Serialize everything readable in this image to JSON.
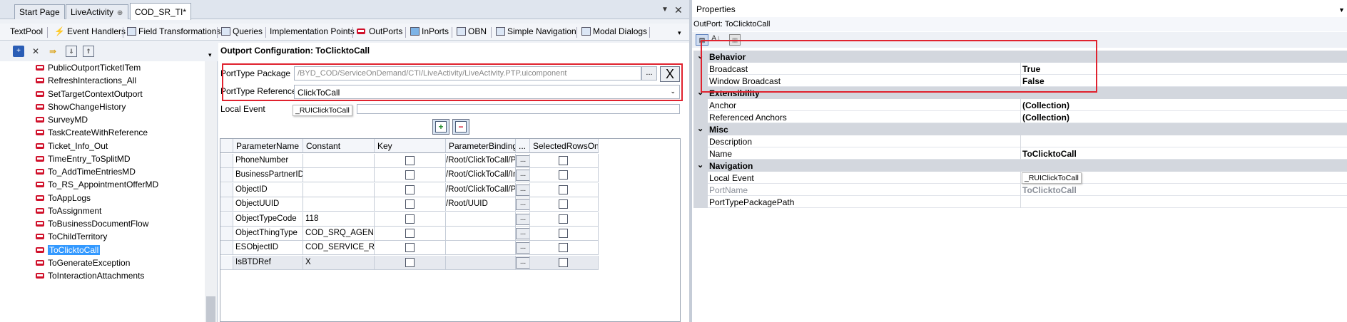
{
  "tabs": [
    {
      "label": "Start Page"
    },
    {
      "label": "LiveActivity"
    },
    {
      "label": "COD_SR_TI*"
    }
  ],
  "subtabs": [
    {
      "label": "TextPool",
      "icon": "textpool-icon"
    },
    {
      "label": "Event Handlers",
      "icon": "lightning-icon"
    },
    {
      "label": "Field Transformations",
      "icon": "transform-icon"
    },
    {
      "label": "Queries",
      "icon": "query-icon"
    },
    {
      "label": "Implementation Points",
      "icon": ""
    },
    {
      "label": "OutPorts",
      "icon": "outport-icon"
    },
    {
      "label": "InPorts",
      "icon": "inport-icon"
    },
    {
      "label": "OBN",
      "icon": "obn-icon"
    },
    {
      "label": "Simple Navigation",
      "icon": "navigation-icon"
    },
    {
      "label": "Modal Dialogs",
      "icon": "dialog-icon"
    }
  ],
  "tree": {
    "items": [
      {
        "label": "PublicOutportTicketITem"
      },
      {
        "label": "RefreshInteractions_All"
      },
      {
        "label": "SetTargetContextOutport"
      },
      {
        "label": "ShowChangeHistory"
      },
      {
        "label": "SurveyMD"
      },
      {
        "label": "TaskCreateWithReference"
      },
      {
        "label": "Ticket_Info_Out"
      },
      {
        "label": "TimeEntry_ToSplitMD"
      },
      {
        "label": "To_AddTimeEntriesMD"
      },
      {
        "label": "To_RS_AppointmentOfferMD"
      },
      {
        "label": "ToAppLogs"
      },
      {
        "label": "ToAssignment"
      },
      {
        "label": "ToBusinessDocumentFlow"
      },
      {
        "label": "ToChildTerritory"
      },
      {
        "label": "ToClicktoCall"
      },
      {
        "label": "ToGenerateException"
      },
      {
        "label": "ToInteractionAttachments"
      }
    ],
    "selected": "ToClicktoCall"
  },
  "config": {
    "title": "Outport Configuration: ToClicktoCall",
    "porttype_package_label": "PortType Package",
    "porttype_package_value": "/BYD_COD/ServiceOnDemand/CTI/LiveActivity/LiveActivity.PTP.uicomponent",
    "browse_label": "...",
    "clear_label": "X",
    "porttype_reference_label": "PortType Reference",
    "porttype_reference_value": "ClickToCall",
    "local_event_label": "Local Event",
    "local_event_value": "",
    "local_event_tooltip": "_RUIClickToCall"
  },
  "grid": {
    "columns": [
      "ParameterName",
      "Constant",
      "Key",
      "ParameterBinding",
      "...",
      "SelectedRowsOnly"
    ],
    "rows": [
      {
        "name": "PhoneNumber",
        "constant": "",
        "binding": "/Root/ClickToCall/Phone"
      },
      {
        "name": "BusinessPartnerID",
        "constant": "",
        "binding": "/Root/ClickToCall/Intern"
      },
      {
        "name": "ObjectID",
        "constant": "",
        "binding": "/Root/ClickToCall/Prede"
      },
      {
        "name": "ObjectUUID",
        "constant": "",
        "binding": "/Root/UUID"
      },
      {
        "name": "ObjectTypeCode",
        "constant": "118",
        "binding": ""
      },
      {
        "name": "ObjectThingType",
        "constant": "COD_SRQ_AGENT_TT",
        "binding": ""
      },
      {
        "name": "ESObjectID",
        "constant": "COD_SERVICE_REQU",
        "binding": ""
      },
      {
        "name": "IsBTDRef",
        "constant": "X",
        "binding": ""
      }
    ],
    "ellipsis": "..."
  },
  "properties": {
    "title": "Properties",
    "subtitle": "OutPort: ToClicktoCall",
    "categories": [
      {
        "name": "Behavior",
        "rows": [
          {
            "name": "Broadcast",
            "value": "True"
          },
          {
            "name": "Window Broadcast",
            "value": "False"
          }
        ]
      },
      {
        "name": "Extensibility",
        "rows": [
          {
            "name": "Anchor",
            "value": "(Collection)"
          },
          {
            "name": "Referenced Anchors",
            "value": "(Collection)"
          }
        ]
      },
      {
        "name": "Misc",
        "rows": [
          {
            "name": "Description",
            "value": ""
          },
          {
            "name": "Name",
            "value": "ToClicktoCall"
          }
        ]
      },
      {
        "name": "Navigation",
        "rows": [
          {
            "name": "Local Event",
            "value": ""
          },
          {
            "name": "PortName",
            "value": "ToClicktoCall"
          },
          {
            "name": "PortTypePackagePath",
            "value": ""
          }
        ]
      }
    ],
    "local_event_tooltip": "_RUIClickToCall"
  },
  "colors": {
    "highlight": "#e0222e",
    "selection": "#3399ff",
    "category_bg": "#d3d7de"
  }
}
